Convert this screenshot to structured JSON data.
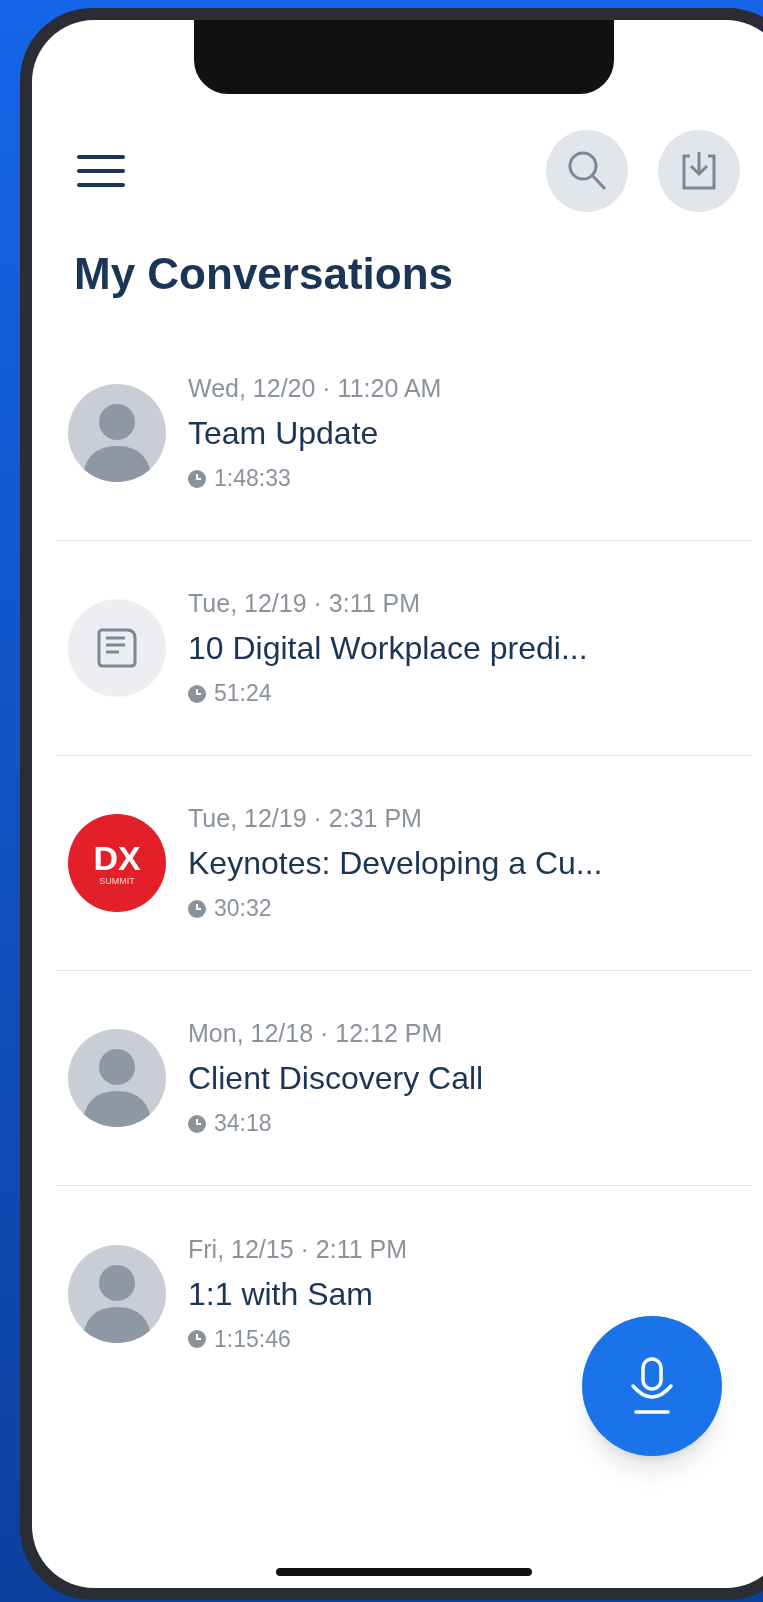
{
  "header": {
    "title": "My Conversations"
  },
  "conversations": [
    {
      "avatar": {
        "kind": "photo"
      },
      "date": "Wed, 12/20 · 11:20 AM",
      "title": "Team Update",
      "duration": "1:48:33"
    },
    {
      "avatar": {
        "kind": "document"
      },
      "date": "Tue, 12/19 · 3:11 PM",
      "title": "10 Digital Workplace predi...",
      "duration": "51:24"
    },
    {
      "avatar": {
        "kind": "logo",
        "text": "DX",
        "subtext": "SUMMIT"
      },
      "date": "Tue, 12/19 · 2:31 PM",
      "title": "Keynotes: Developing a Cu...",
      "duration": "30:32"
    },
    {
      "avatar": {
        "kind": "photo"
      },
      "date": "Mon, 12/18 · 12:12 PM",
      "title": "Client Discovery Call",
      "duration": "34:18"
    },
    {
      "avatar": {
        "kind": "photo"
      },
      "date": "Fri, 12/15 · 2:11 PM",
      "title": "1:1 with Sam",
      "duration": "1:15:46"
    }
  ]
}
